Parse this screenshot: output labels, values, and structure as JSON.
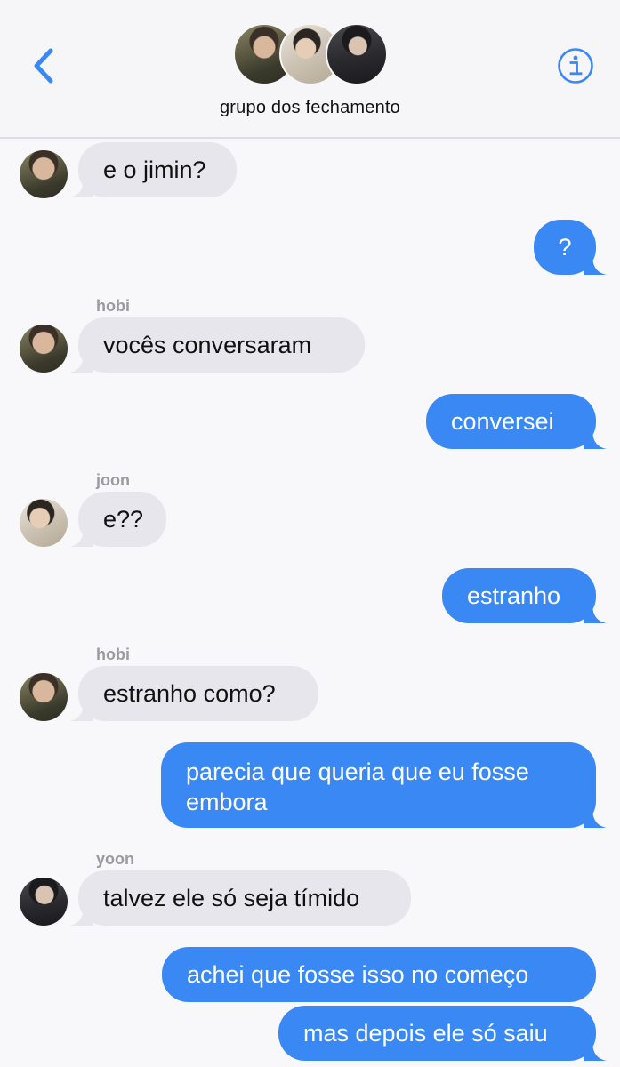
{
  "header": {
    "back_label": "",
    "title": "grupo dos fechamento",
    "info_label": "i"
  },
  "messages": [
    {
      "from": "hobi",
      "side": "in",
      "show_name": false,
      "text": "e o jimin?"
    },
    {
      "from": "me",
      "side": "out",
      "text": "?"
    },
    {
      "from": "hobi",
      "side": "in",
      "show_name": true,
      "name": "hobi",
      "text": "vocês conversaram"
    },
    {
      "from": "me",
      "side": "out",
      "text": "conversei"
    },
    {
      "from": "joon",
      "side": "in",
      "show_name": true,
      "name": "joon",
      "text": "e??"
    },
    {
      "from": "me",
      "side": "out",
      "text": "estranho"
    },
    {
      "from": "hobi",
      "side": "in",
      "show_name": true,
      "name": "hobi",
      "text": "estranho como?"
    },
    {
      "from": "me",
      "side": "out",
      "text": "parecia que queria que eu fosse embora"
    },
    {
      "from": "yoon",
      "side": "in",
      "show_name": true,
      "name": "yoon",
      "text": "talvez ele só seja tímido"
    },
    {
      "from": "me",
      "side": "out",
      "text": "achei que fosse isso no começo"
    },
    {
      "from": "me",
      "side": "out",
      "text": "mas depois ele só saiu"
    }
  ],
  "colors": {
    "outgoing": "#3a88f4",
    "incoming": "#e7e6ed",
    "accent": "#3a88f4"
  }
}
